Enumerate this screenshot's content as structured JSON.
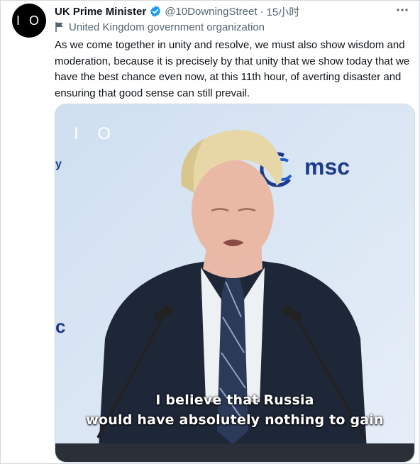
{
  "tweet": {
    "avatar_text": "I O",
    "display_name": "UK Prime Minister",
    "handle": "@10DowningStreet",
    "separator": "·",
    "time": "15小时",
    "affiliation": "United Kingdom government organization",
    "text": "As we come together in unity and resolve, we must also show wisdom and moderation, because it is precisely by that unity that we show today that we have the best chance even now, at this 11th hour, of averting disaster and ensuring that good sense can still prevail."
  },
  "media": {
    "logo_text": "I O",
    "msc_text": "msc",
    "edge_left_top": "y",
    "edge_left_mid": "c",
    "caption_line1": "I believe that Russia",
    "caption_line2": "would have absolutely nothing to gain"
  },
  "colors": {
    "verified": "#1d9bf0",
    "secondary_text": "#536471",
    "border": "#cfd9de"
  }
}
